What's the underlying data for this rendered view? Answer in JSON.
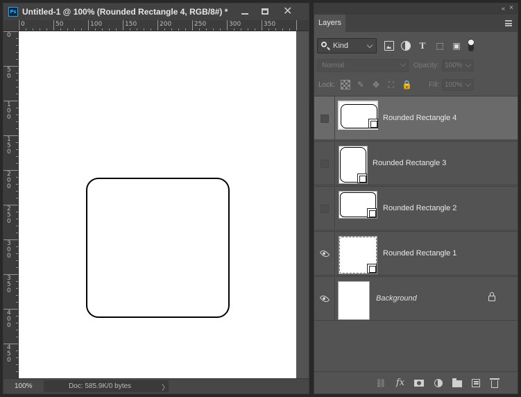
{
  "document": {
    "title": "Untitled-1 @ 100% (Rounded Rectangle 4, RGB/8#) *",
    "app_icon": "Ps",
    "zoom": "100%",
    "doc_size": "Doc: 585.9K/0 bytes",
    "status_arrow": "〉",
    "ruler_h_labels": [
      "0",
      "50",
      "100",
      "150",
      "200",
      "250",
      "300",
      "350"
    ],
    "ruler_v_labels": [
      "0",
      "50",
      "100",
      "150",
      "200",
      "250",
      "300",
      "350",
      "400",
      "450"
    ]
  },
  "panel": {
    "collapse_glyph": "«",
    "close_glyph": "×",
    "tab_layers": "Layers",
    "filter_kind": "Kind",
    "filter_type_glyph": "T",
    "filter_shape_glyph": "⬚",
    "filter_smart_glyph": "▣",
    "blend_mode": "Normal",
    "opacity_label": "Opacity:",
    "opacity_value": "100%",
    "lock_label": "Lock:",
    "lock_brush_glyph": "✎",
    "lock_move_glyph": "✥",
    "lock_artboard_glyph": "⛶",
    "lock_all_glyph": "🔒",
    "fill_label": "Fill:",
    "fill_value": "100%",
    "layers": [
      {
        "name": "Rounded Rectangle 4",
        "visible": false,
        "selected": true
      },
      {
        "name": "Rounded Rectangle 3",
        "visible": false,
        "selected": false
      },
      {
        "name": "Rounded Rectangle 2",
        "visible": false,
        "selected": false
      },
      {
        "name": "Rounded Rectangle 1",
        "visible": true,
        "selected": false
      },
      {
        "name": "Background",
        "visible": true,
        "selected": false,
        "locked": true
      }
    ],
    "bottom": {
      "link_glyph": "⛓",
      "fx_label": "fx"
    }
  },
  "icons": {
    "window_close": "✕"
  }
}
